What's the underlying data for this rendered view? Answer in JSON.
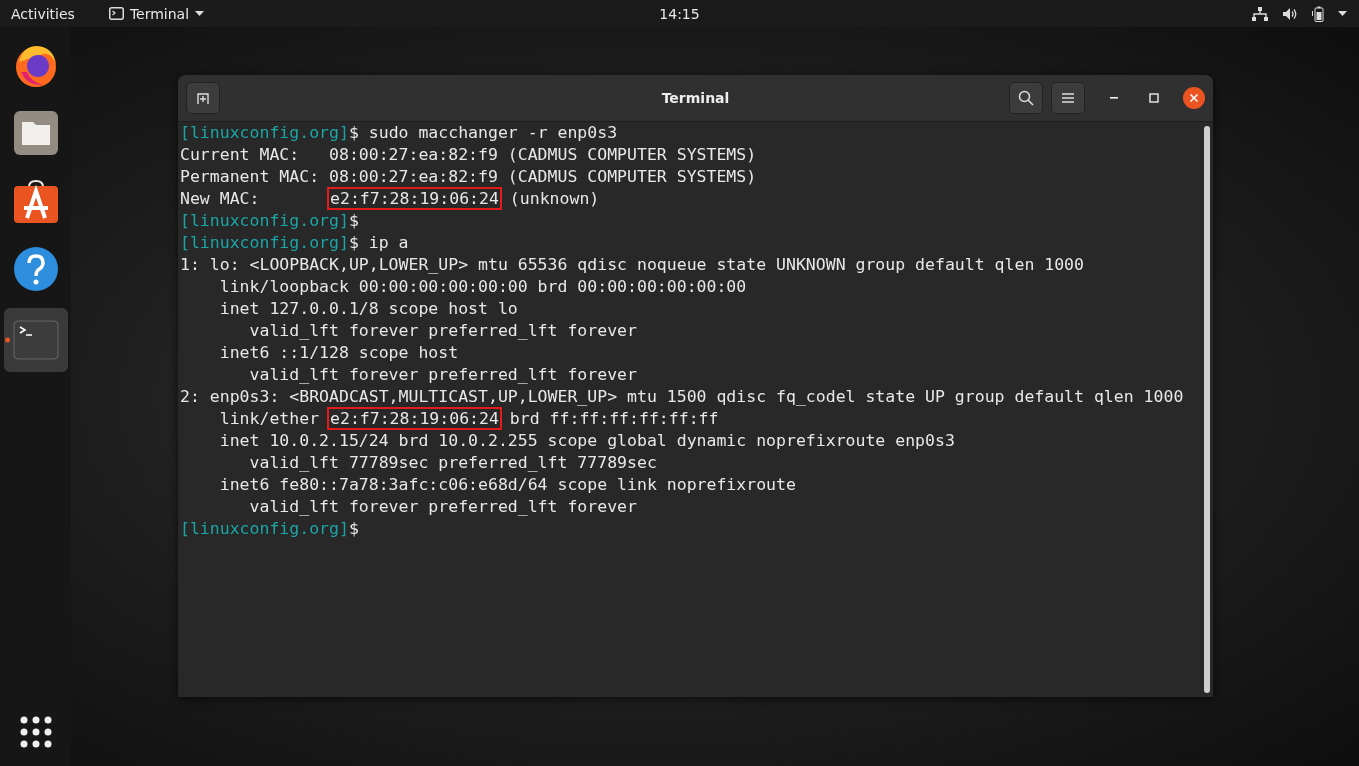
{
  "top_bar": {
    "activities": "Activities",
    "app_menu": "Terminal",
    "clock": "14:15"
  },
  "dock": {
    "items": [
      {
        "kind": "browser",
        "selected": false,
        "running": false
      },
      {
        "kind": "files",
        "selected": false,
        "running": false
      },
      {
        "kind": "store",
        "selected": false,
        "running": false
      },
      {
        "kind": "help",
        "selected": false,
        "running": false
      },
      {
        "kind": "terminal",
        "selected": true,
        "running": true
      }
    ]
  },
  "window": {
    "title": "Terminal",
    "lines": [
      [
        {
          "kind": "prompt",
          "text": "[linuxconfig.org]"
        },
        {
          "kind": "text",
          "text": "$ sudo macchanger -r enp0s3"
        }
      ],
      [
        {
          "kind": "text",
          "text": "Current MAC:   08:00:27:ea:82:f9 (CADMUS COMPUTER SYSTEMS)"
        }
      ],
      [
        {
          "kind": "text",
          "text": "Permanent MAC: 08:00:27:ea:82:f9 (CADMUS COMPUTER SYSTEMS)"
        }
      ],
      [
        {
          "kind": "text",
          "text": "New MAC:       "
        },
        {
          "kind": "boxed",
          "text": "e2:f7:28:19:06:24"
        },
        {
          "kind": "text",
          "text": " (unknown)"
        }
      ],
      [
        {
          "kind": "prompt",
          "text": "[linuxconfig.org]"
        },
        {
          "kind": "text",
          "text": "$"
        }
      ],
      [
        {
          "kind": "prompt",
          "text": "[linuxconfig.org]"
        },
        {
          "kind": "text",
          "text": "$ ip a"
        }
      ],
      [
        {
          "kind": "text",
          "text": "1: lo: <LOOPBACK,UP,LOWER_UP> mtu 65536 qdisc noqueue state UNKNOWN group default qlen 1000"
        }
      ],
      [
        {
          "kind": "text",
          "text": "    link/loopback 00:00:00:00:00:00 brd 00:00:00:00:00:00"
        }
      ],
      [
        {
          "kind": "text",
          "text": "    inet 127.0.0.1/8 scope host lo"
        }
      ],
      [
        {
          "kind": "text",
          "text": "       valid_lft forever preferred_lft forever"
        }
      ],
      [
        {
          "kind": "text",
          "text": "    inet6 ::1/128 scope host"
        }
      ],
      [
        {
          "kind": "text",
          "text": "       valid_lft forever preferred_lft forever"
        }
      ],
      [
        {
          "kind": "text",
          "text": "2: enp0s3: <BROADCAST,MULTICAST,UP,LOWER_UP> mtu 1500 qdisc fq_codel state UP group default qlen 1000"
        }
      ],
      [
        {
          "kind": "text",
          "text": "    link/ether "
        },
        {
          "kind": "boxed",
          "text": "e2:f7:28:19:06:24"
        },
        {
          "kind": "text",
          "text": " brd ff:ff:ff:ff:ff:ff"
        }
      ],
      [
        {
          "kind": "text",
          "text": "    inet 10.0.2.15/24 brd 10.0.2.255 scope global dynamic noprefixroute enp0s3"
        }
      ],
      [
        {
          "kind": "text",
          "text": "       valid_lft 77789sec preferred_lft 77789sec"
        }
      ],
      [
        {
          "kind": "text",
          "text": "    inet6 fe80::7a78:3afc:c06:e68d/64 scope link noprefixroute"
        }
      ],
      [
        {
          "kind": "text",
          "text": "       valid_lft forever preferred_lft forever"
        }
      ],
      [
        {
          "kind": "prompt",
          "text": "[linuxconfig.org]"
        },
        {
          "kind": "text",
          "text": "$"
        }
      ]
    ]
  }
}
